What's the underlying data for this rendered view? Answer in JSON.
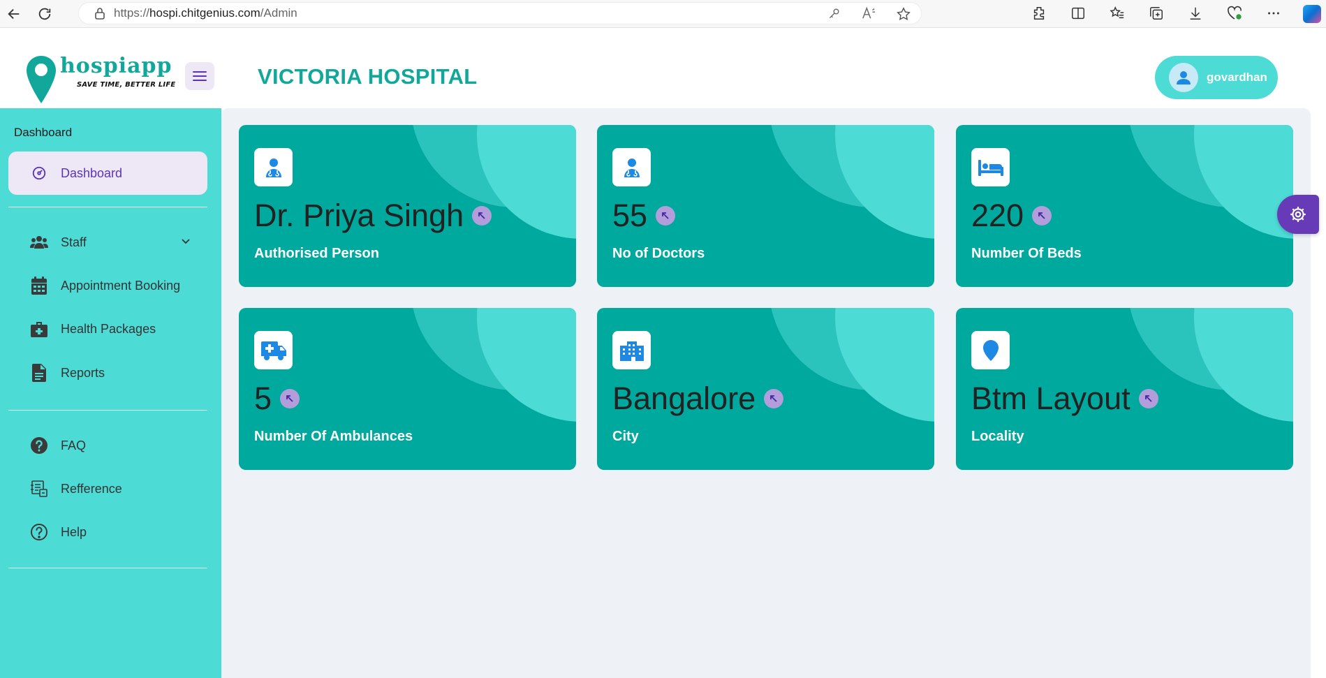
{
  "browser": {
    "url_prefix": "https://",
    "url_host": "hospi.chitgenius.com",
    "url_path": "/Admin"
  },
  "header": {
    "logo_name": "hospiapp",
    "logo_tagline": "SAVE TIME, BETTER LIFE",
    "hospital_name": "VICTORIA HOSPITAL",
    "user_name": "govardhan"
  },
  "sidebar": {
    "section_title": "Dashboard",
    "items": [
      {
        "label": "Dashboard",
        "icon": "dashboard-gauge-icon",
        "active": true
      },
      {
        "label": "Staff",
        "icon": "people-icon",
        "has_submenu": true
      },
      {
        "label": "Appointment Booking",
        "icon": "calendar-icon"
      },
      {
        "label": "Health Packages",
        "icon": "medical-kit-icon"
      },
      {
        "label": "Reports",
        "icon": "document-icon"
      },
      {
        "label": "FAQ",
        "icon": "question-circle-icon"
      },
      {
        "label": "Refference",
        "icon": "reference-list-icon"
      },
      {
        "label": "Help",
        "icon": "help-circle-icon"
      }
    ]
  },
  "cards": [
    {
      "value": "Dr. Priya Singh",
      "label": "Authorised Person",
      "icon": "doctor-icon"
    },
    {
      "value": "55",
      "label": "No of Doctors",
      "icon": "doctor-icon"
    },
    {
      "value": "220",
      "label": "Number Of Beds",
      "icon": "bed-icon"
    },
    {
      "value": "5",
      "label": "Number Of Ambulances",
      "icon": "ambulance-icon"
    },
    {
      "value": "Bangalore",
      "label": "City",
      "icon": "city-building-icon"
    },
    {
      "value": "Btm Layout",
      "label": "Locality",
      "icon": "location-pin-icon"
    }
  ],
  "colors": {
    "sidebar_bg": "#4ddbd6",
    "card_bg": "#00a99d",
    "brand_teal": "#11a89b",
    "accent_purple": "#673ab7",
    "active_bg": "#ede7f6"
  }
}
